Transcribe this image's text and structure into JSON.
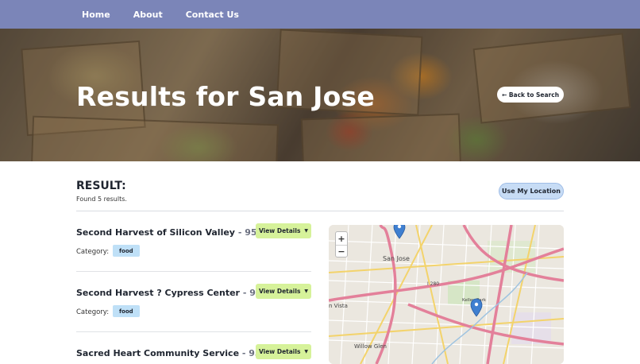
{
  "nav": {
    "home": "Home",
    "about": "About",
    "contact": "Contact Us"
  },
  "hero": {
    "title": "Results for San Jose",
    "back_label": "← Back to Search"
  },
  "results": {
    "heading": "RESULT:",
    "count_text": "Found 5 results.",
    "location_button": "Use My Location",
    "items": [
      {
        "name": "Second Harvest of Silicon Valley",
        "zip": "- 95125",
        "details_label": "View Details",
        "category_label": "Category:",
        "category": "food"
      },
      {
        "name": "Second Harvest ? Cypress Center",
        "zip": "- 95136",
        "details_label": "View Details",
        "category_label": "Category:",
        "category": "food"
      },
      {
        "name": "Sacred Heart Community Service",
        "zip": "- 95110",
        "details_label": "View Details"
      }
    ]
  },
  "map": {
    "zoom_in": "+",
    "zoom_out": "−",
    "labels": {
      "san_jose": "San Jose",
      "vista": "n Vista",
      "willow_glen": "Willow Glen",
      "road_280": "I 280",
      "kelley_park": "Kelley Park"
    },
    "colors": {
      "marker": "#3f7fd0",
      "highway": "#e3809a",
      "major_road": "#f3d36b"
    }
  }
}
